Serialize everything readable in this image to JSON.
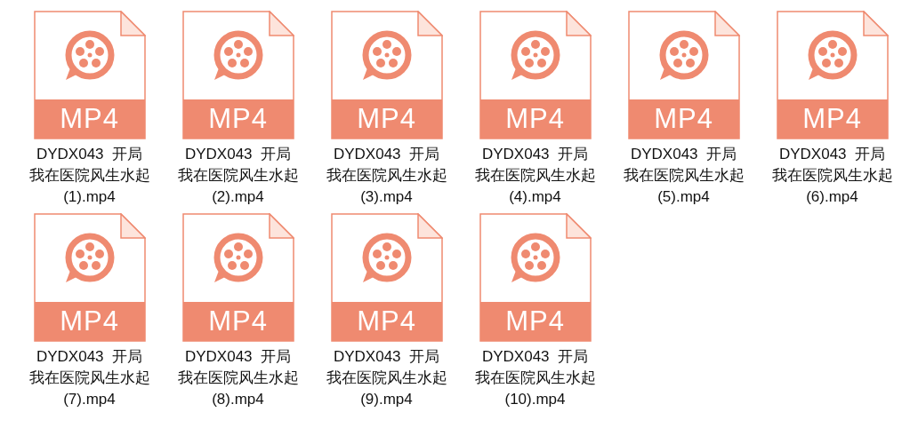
{
  "files": [
    {
      "name": "DYDX043  开局我在医院风生水起 (1).mp4",
      "badge": "MP4"
    },
    {
      "name": "DYDX043  开局我在医院风生水起 (2).mp4",
      "badge": "MP4"
    },
    {
      "name": "DYDX043  开局我在医院风生水起 (3).mp4",
      "badge": "MP4"
    },
    {
      "name": "DYDX043  开局我在医院风生水起 (4).mp4",
      "badge": "MP4"
    },
    {
      "name": "DYDX043  开局我在医院风生水起 (5).mp4",
      "badge": "MP4"
    },
    {
      "name": "DYDX043  开局我在医院风生水起 (6).mp4",
      "badge": "MP4"
    },
    {
      "name": "DYDX043  开局我在医院风生水起 (7).mp4",
      "badge": "MP4"
    },
    {
      "name": "DYDX043  开局我在医院风生水起 (8).mp4",
      "badge": "MP4"
    },
    {
      "name": "DYDX043  开局我在医院风生水起 (9).mp4",
      "badge": "MP4"
    },
    {
      "name": "DYDX043  开局我在医院风生水起 (10).mp4",
      "badge": "MP4"
    }
  ]
}
